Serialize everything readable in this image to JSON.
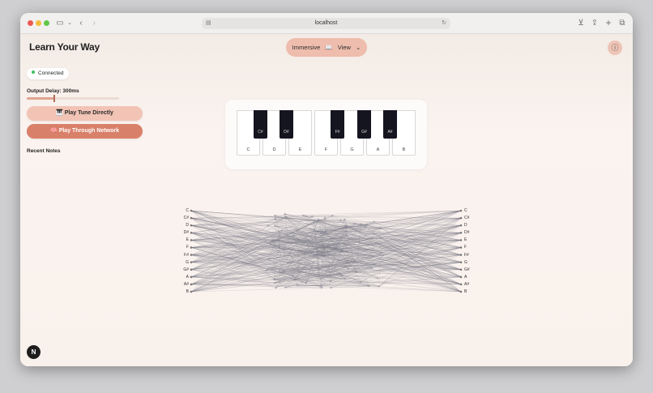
{
  "browser": {
    "url": "localhost"
  },
  "app": {
    "title": "Learn Your Way",
    "view_selector": {
      "mode": "Immersive",
      "icon": "📖",
      "label": "View",
      "chevron": "⌄"
    },
    "info_icon": "ⓘ"
  },
  "controls": {
    "status": "Connected",
    "status_color": "#3fbf5f",
    "output_delay_label": "Output Delay: 300ms",
    "delay_fraction": 0.3,
    "play_direct_icon": "🎹",
    "play_direct_label": "Play Tune Directly",
    "play_network_icon": "🧠",
    "play_network_label": "Play Through Network",
    "recent_notes_label": "Recent Notes"
  },
  "piano": {
    "white_keys": [
      "C",
      "D",
      "E",
      "F",
      "G",
      "A",
      "B"
    ],
    "black_keys": [
      "C#",
      "D#",
      "F#",
      "G#",
      "A#"
    ]
  },
  "network": {
    "input_labels": [
      "C",
      "C#",
      "D",
      "D#",
      "E",
      "F",
      "F#",
      "G",
      "G#",
      "A",
      "A#",
      "B"
    ],
    "output_labels": [
      "C",
      "C#",
      "D",
      "D#",
      "E",
      "F",
      "F#",
      "G",
      "G#",
      "A",
      "A#",
      "B"
    ]
  },
  "footer": {
    "badge": "N"
  },
  "colors": {
    "accent": "#eebdad",
    "button_primary": "#d9806a",
    "button_secondary": "#f2c4b6"
  }
}
